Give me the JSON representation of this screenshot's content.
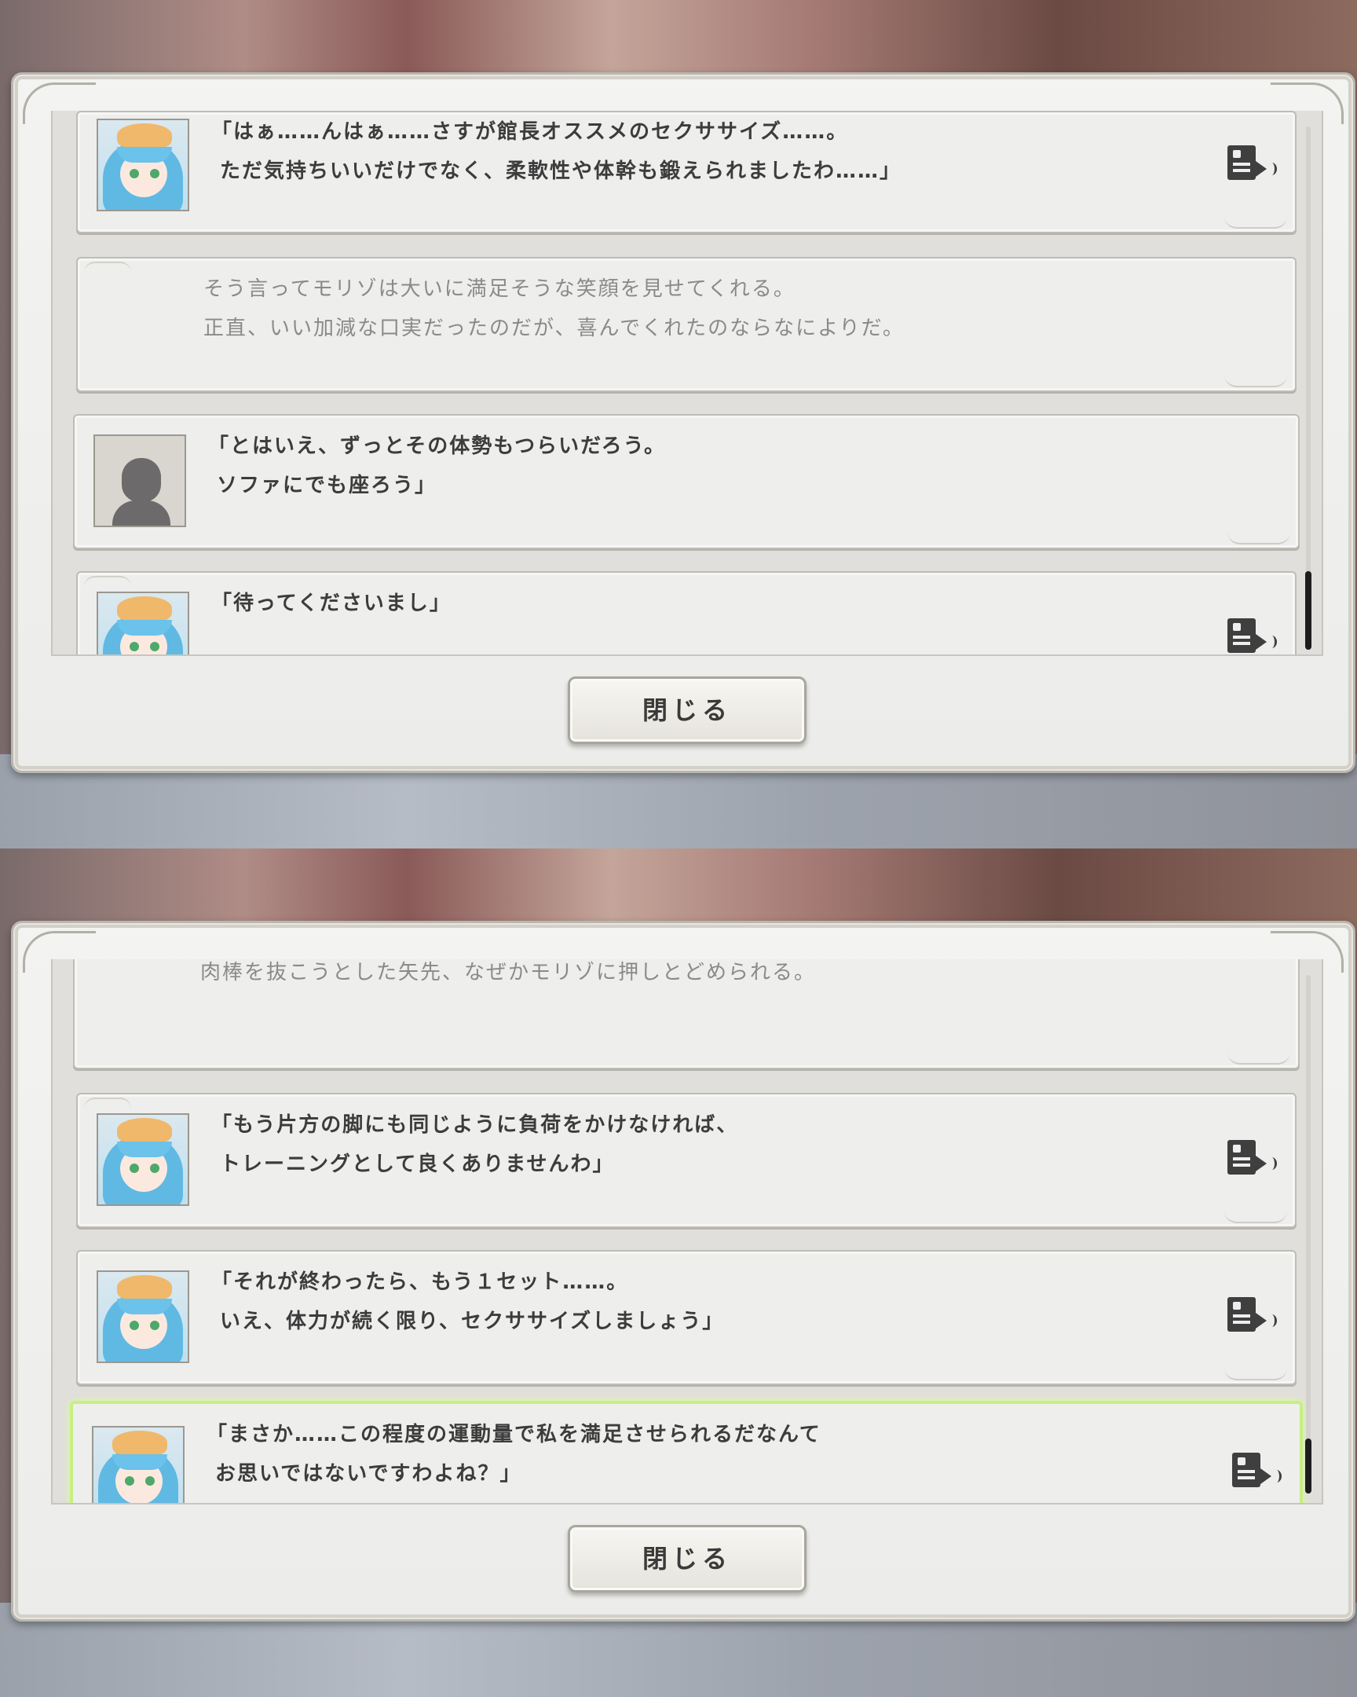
{
  "screens": [
    {
      "entries": [
        {
          "speaker": "girl",
          "line1": "「はぁ……んはぁ……さすが館長オススメのセクササイズ……。",
          "line2": " ただ気持ちいいだけでなく、柔軟性や体幹も鍛えられましたわ……」",
          "voice": true
        },
        {
          "speaker": "narration",
          "line1": "そう言ってモリゾは大いに満足そうな笑顔を見せてくれる。",
          "line2": "正直、いい加減な口実だったのだが、喜んでくれたのならなによりだ。",
          "voice": false
        },
        {
          "speaker": "hero",
          "line1": "「とはいえ、ずっとその体勢もつらいだろう。",
          "line2": " ソファにでも座ろう」",
          "voice": false
        },
        {
          "speaker": "girl",
          "line1": "「待ってくださいまし」",
          "line2": "",
          "voice": true
        }
      ],
      "close_label": "閉じる"
    },
    {
      "entries": [
        {
          "speaker": "narration",
          "line1": "肉棒を抜こうとした矢先、なぜかモリゾに押しとどめられる。",
          "line2": "",
          "voice": false
        },
        {
          "speaker": "girl",
          "line1": "「もう片方の脚にも同じように負荷をかけなければ、",
          "line2": " トレーニングとして良くありませんわ」",
          "voice": true
        },
        {
          "speaker": "girl",
          "line1": "「それが終わったら、もう１セット……。",
          "line2": " いえ、体力が続く限り、セクササイズしましょう」",
          "voice": true
        },
        {
          "speaker": "girl",
          "line1": "「まさか……この程度の運動量で私を満足させられるだなんて",
          "line2": " お思いではないですわよね？」",
          "voice": true
        }
      ],
      "close_label": "閉じる"
    }
  ],
  "icons": {
    "voice": "voice-replay-icon"
  },
  "colors": {
    "highlight": "#c7ef84",
    "text": "#3c3c3c",
    "narration": "#8a8a88"
  }
}
